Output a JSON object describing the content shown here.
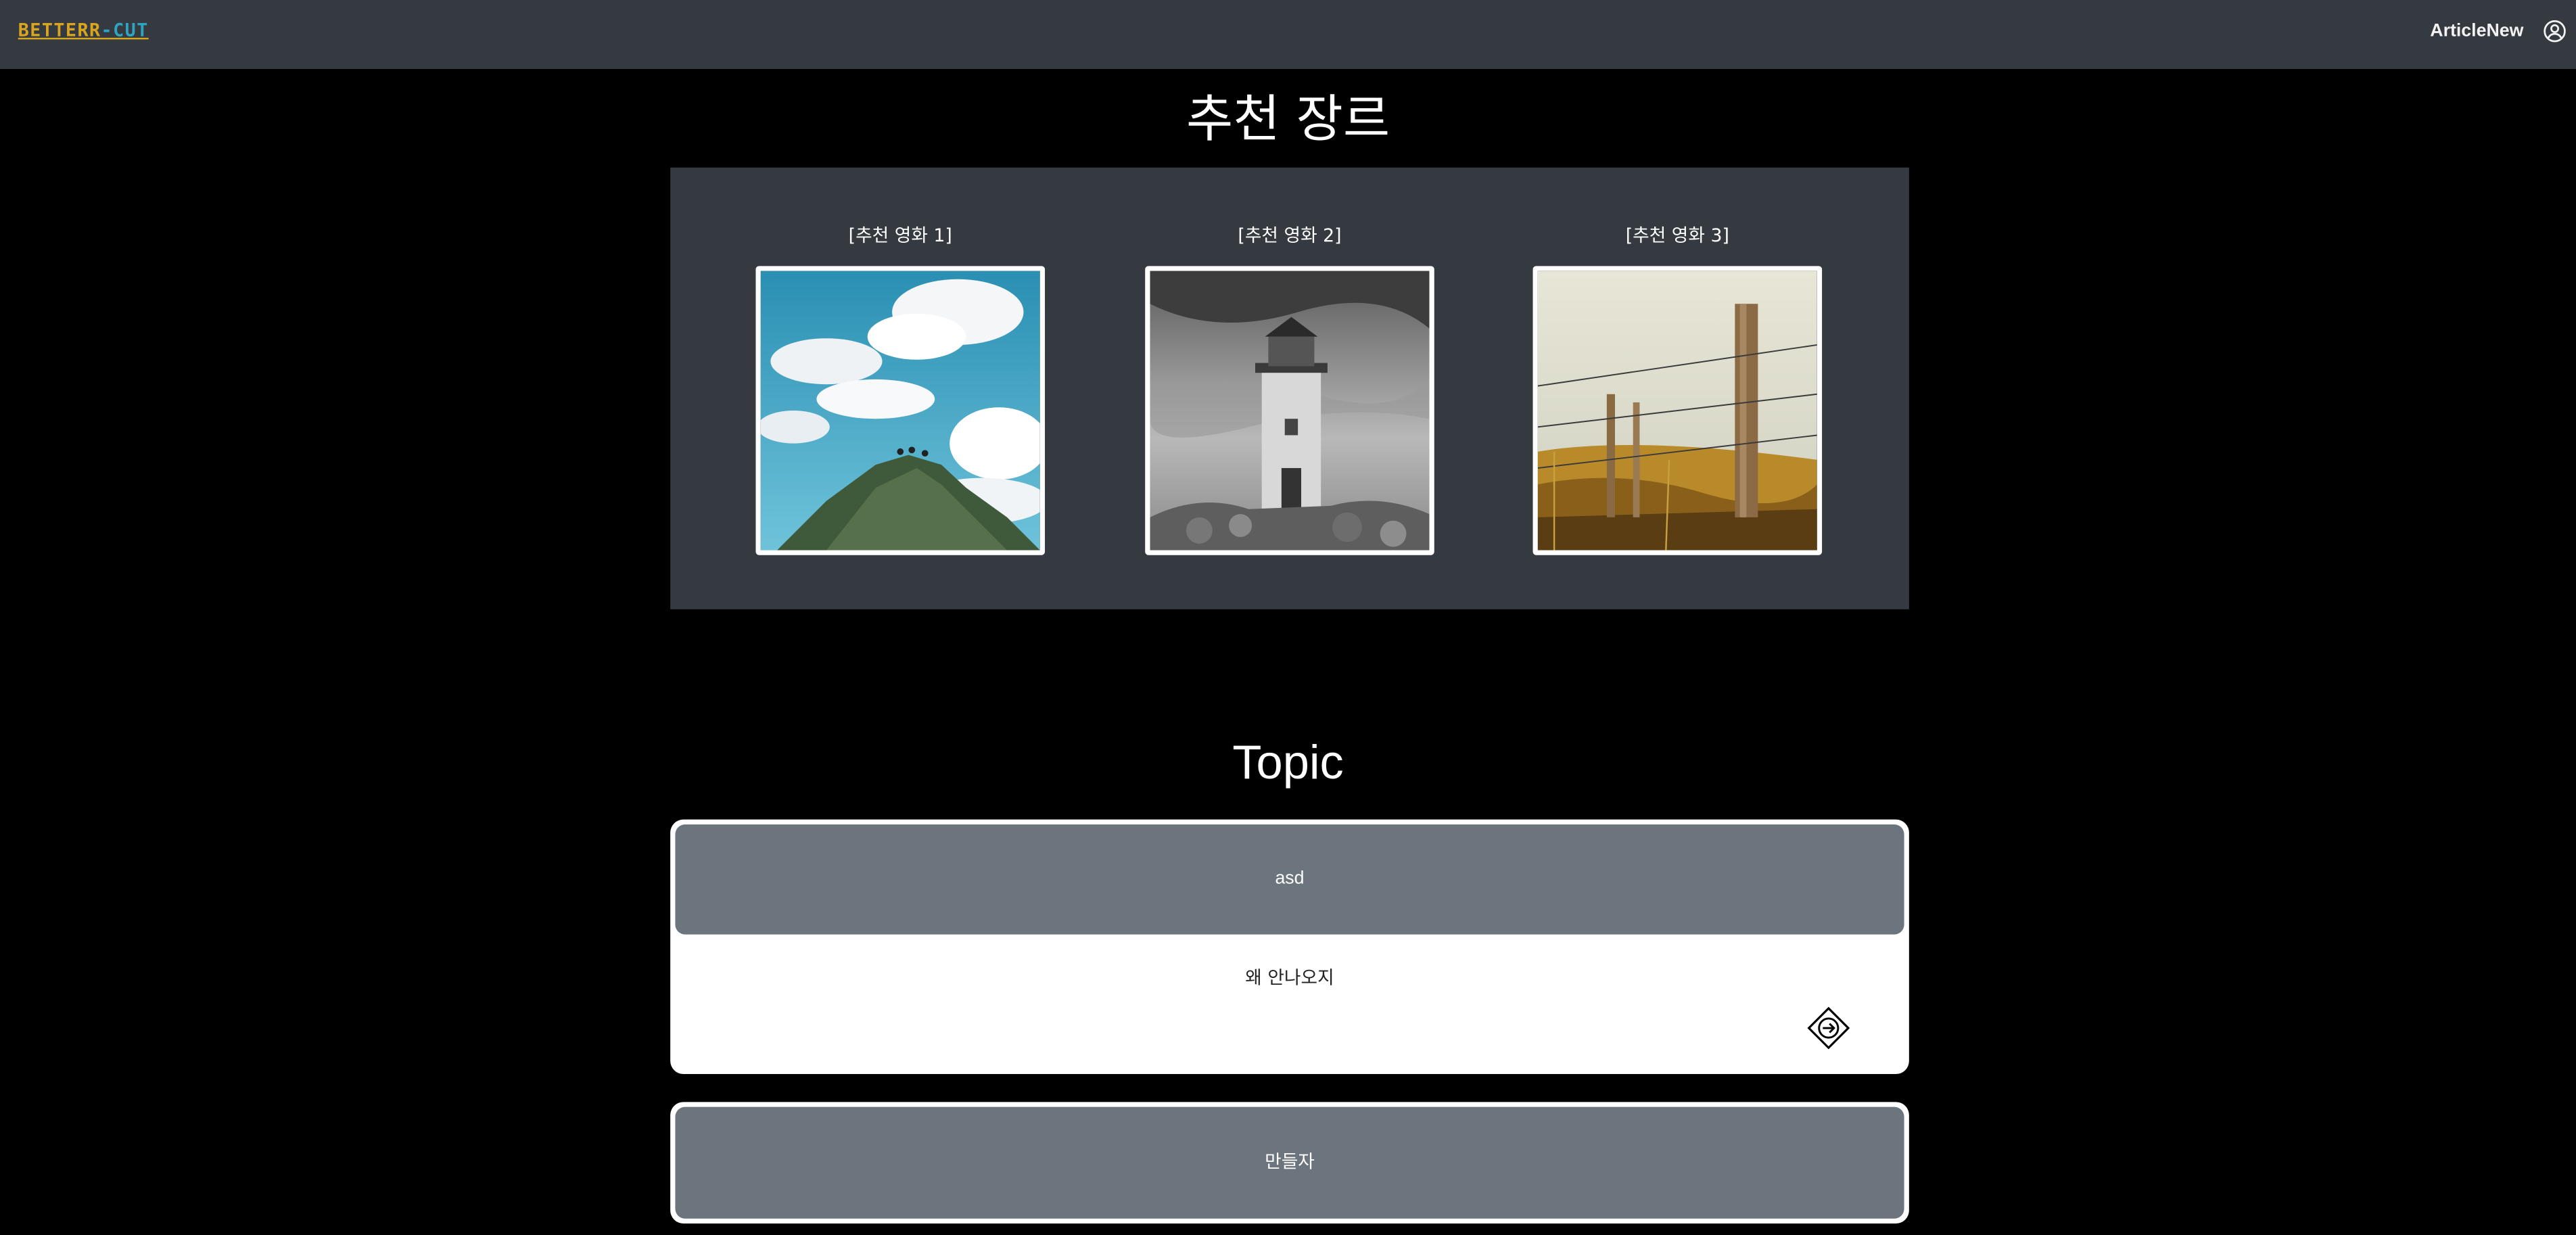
{
  "navbar": {
    "logo_part1": "BETTERR",
    "logo_part2": "-CUT",
    "link_label": "ArticleNew",
    "user_icon": "user-circle-icon"
  },
  "colors": {
    "navbar_bg": "#343a40",
    "page_bg": "#000000",
    "logo_gold": "#d9a520",
    "logo_blue": "#2ea3c2",
    "topic_head_bg": "#6c757d"
  },
  "recommend": {
    "title": "추천 장르",
    "movies": [
      {
        "label": "[추천 영화 1]",
        "image": "sky-clouds-rock-photo"
      },
      {
        "label": "[추천 영화 2]",
        "image": "lighthouse-bw-photo"
      },
      {
        "label": "[추천 영화 3]",
        "image": "fence-post-field-photo"
      }
    ]
  },
  "topics": {
    "title": "Topic",
    "items": [
      {
        "title": "asd",
        "body": "왜 안나오지",
        "action_icon": "arrow-right-diamond-icon"
      },
      {
        "title": "만들자"
      }
    ]
  }
}
